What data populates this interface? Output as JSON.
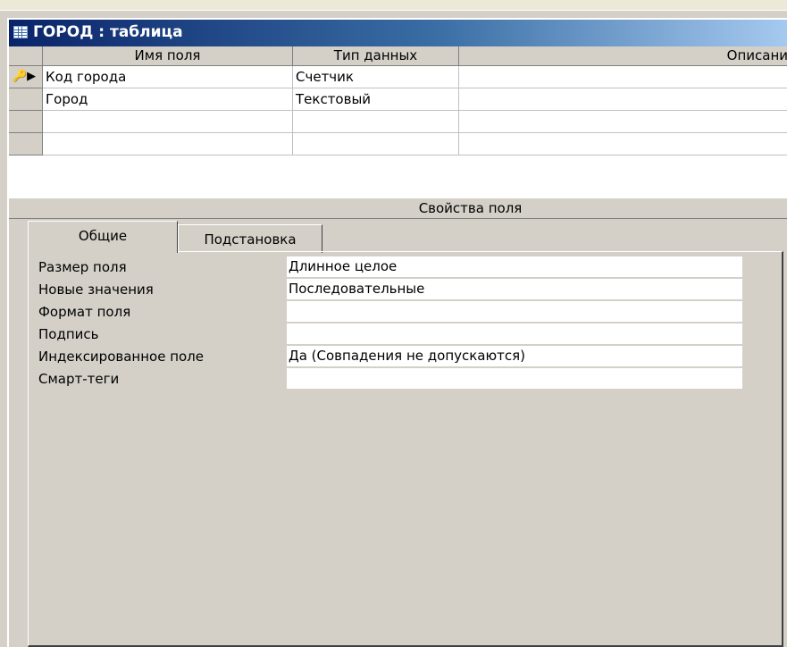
{
  "window": {
    "title": "ГОРОД : таблица"
  },
  "grid": {
    "columns": [
      "Имя поля",
      "Тип данных",
      "Описани"
    ],
    "rows": [
      {
        "field": "Код города",
        "type": "Счетчик",
        "description": "",
        "marker": "primary-key-current"
      },
      {
        "field": "Город",
        "type": "Текстовый",
        "description": ""
      },
      {
        "field": "",
        "type": "",
        "description": ""
      },
      {
        "field": "",
        "type": "",
        "description": ""
      }
    ]
  },
  "properties": {
    "caption": "Свойства поля",
    "tabs": [
      {
        "label": "Общие",
        "active": true
      },
      {
        "label": "Подстановка",
        "active": false
      }
    ],
    "fields": [
      {
        "label": "Размер поля",
        "value": "Длинное целое"
      },
      {
        "label": "Новые значения",
        "value": "Последовательные"
      },
      {
        "label": "Формат поля",
        "value": ""
      },
      {
        "label": "Подпись",
        "value": ""
      },
      {
        "label": "Индексированное поле",
        "value": "Да (Совпадения не допускаются)"
      },
      {
        "label": "Смарт-теги",
        "value": ""
      }
    ]
  },
  "colors": {
    "title_gradient_start": "#0a246a",
    "title_gradient_end": "#a6caf0",
    "window_bg": "#d4d0c8"
  }
}
